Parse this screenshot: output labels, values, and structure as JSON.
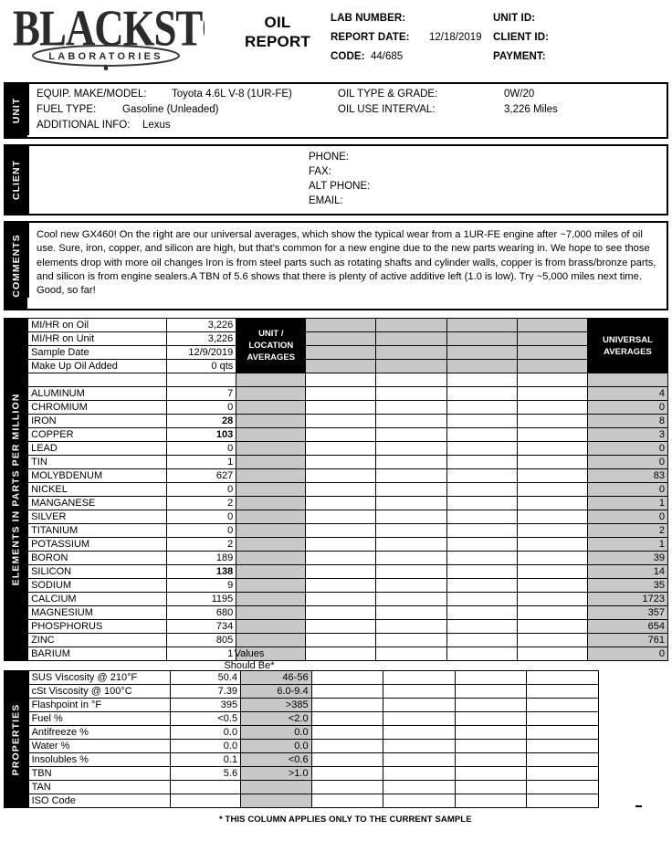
{
  "header": {
    "logo_main": "BLACKSTONE",
    "logo_sub": "LABORATORIES",
    "title_line1": "OIL",
    "title_line2": "REPORT",
    "lab_number_label": "LAB NUMBER:",
    "lab_number_value": "",
    "report_date_label": "REPORT DATE:",
    "report_date_value": "12/18/2019",
    "code_label": "CODE:",
    "code_value": "44/685",
    "unit_id_label": "UNIT ID:",
    "unit_id_value": "",
    "client_id_label": "CLIENT ID:",
    "client_id_value": "",
    "payment_label": "PAYMENT:",
    "payment_value": ""
  },
  "unit": {
    "tab": "UNIT",
    "equip_label": "EQUIP. MAKE/MODEL:",
    "equip_value": "Toyota 4.6L V-8 (1UR-FE)",
    "fuel_label": "FUEL TYPE:",
    "fuel_value": "Gasoline (Unleaded)",
    "additional_label": "ADDITIONAL INFO:",
    "additional_value": "Lexus",
    "oil_type_label": "OIL TYPE & GRADE:",
    "oil_type_value": "0W/20",
    "oil_interval_label": "OIL USE INTERVAL:",
    "oil_interval_value": "3,226 Miles"
  },
  "client": {
    "tab": "CLIENT",
    "phone_label": "PHONE:",
    "phone_value": "",
    "fax_label": "FAX:",
    "fax_value": "",
    "alt_phone_label": "ALT PHONE:",
    "alt_phone_value": "",
    "email_label": "EMAIL:",
    "email_value": ""
  },
  "comments": {
    "tab": "COMMENTS",
    "text": "Cool new GX460! On the right are our universal averages, which show the typical wear from a 1UR-FE engine after ~7,000 miles of oil use. Sure, iron, copper, and silicon are high, but that's common for a new engine due to the new parts wearing in. We hope to see those elements drop with more oil changes Iron is from steel parts such as rotating shafts and cylinder walls, copper is from brass/bronze parts, and silicon is from engine sealers.A TBN of 5.6 shows that there is plenty of active additive left (1.0 is low). Try ~5,000 miles next time. Good, so far!"
  },
  "elements": {
    "tab": "ELEMENTS IN PARTS PER MILLION",
    "unit_location_header": "UNIT /\nLOCATION\nAVERAGES",
    "unit_location_header_lines": [
      "UNIT /",
      "LOCATION",
      "AVERAGES"
    ],
    "universal_header_lines": [
      "UNIVERSAL",
      "AVERAGES"
    ],
    "sample_info": [
      {
        "label": "MI/HR on Oil",
        "value": "3,226"
      },
      {
        "label": "MI/HR on Unit",
        "value": "3,226"
      },
      {
        "label": "Sample Date",
        "value": "12/9/2019"
      },
      {
        "label": "Make Up Oil Added",
        "value": "0 qts"
      }
    ],
    "rows": [
      {
        "label": "ALUMINUM",
        "value": "7",
        "bold": false,
        "universal": "4"
      },
      {
        "label": "CHROMIUM",
        "value": "0",
        "bold": false,
        "universal": "0"
      },
      {
        "label": "IRON",
        "value": "28",
        "bold": true,
        "universal": "8"
      },
      {
        "label": "COPPER",
        "value": "103",
        "bold": true,
        "universal": "3"
      },
      {
        "label": "LEAD",
        "value": "0",
        "bold": false,
        "universal": "0"
      },
      {
        "label": "TIN",
        "value": "1",
        "bold": false,
        "universal": "0"
      },
      {
        "label": "MOLYBDENUM",
        "value": "627",
        "bold": false,
        "universal": "83"
      },
      {
        "label": "NICKEL",
        "value": "0",
        "bold": false,
        "universal": "0"
      },
      {
        "label": "MANGANESE",
        "value": "2",
        "bold": false,
        "universal": "1"
      },
      {
        "label": "SILVER",
        "value": "0",
        "bold": false,
        "universal": "0"
      },
      {
        "label": "TITANIUM",
        "value": "0",
        "bold": false,
        "universal": "2"
      },
      {
        "label": "POTASSIUM",
        "value": "2",
        "bold": false,
        "universal": "1"
      },
      {
        "label": "BORON",
        "value": "189",
        "bold": false,
        "universal": "39"
      },
      {
        "label": "SILICON",
        "value": "138",
        "bold": true,
        "universal": "14"
      },
      {
        "label": "SODIUM",
        "value": "9",
        "bold": false,
        "universal": "35"
      },
      {
        "label": "CALCIUM",
        "value": "1195",
        "bold": false,
        "universal": "1723"
      },
      {
        "label": "MAGNESIUM",
        "value": "680",
        "bold": false,
        "universal": "357"
      },
      {
        "label": "PHOSPHORUS",
        "value": "734",
        "bold": false,
        "universal": "654"
      },
      {
        "label": "ZINC",
        "value": "805",
        "bold": false,
        "universal": "761"
      },
      {
        "label": "BARIUM",
        "value": "1",
        "bold": false,
        "universal": "0"
      }
    ]
  },
  "properties": {
    "tab": "PROPERTIES",
    "values_header_lines": [
      "Values",
      "Should Be*"
    ],
    "rows": [
      {
        "label": "SUS Viscosity @ 210°F",
        "value": "50.4",
        "should_be": "46-56"
      },
      {
        "label": "cSt Viscosity @ 100°C",
        "value": "7.39",
        "should_be": "6.0-9.4"
      },
      {
        "label": "Flashpoint in °F",
        "value": "395",
        "should_be": ">385"
      },
      {
        "label": "Fuel %",
        "value": "<0.5",
        "should_be": "<2.0"
      },
      {
        "label": "Antifreeze %",
        "value": "0.0",
        "should_be": "0.0"
      },
      {
        "label": "Water %",
        "value": "0.0",
        "should_be": "0.0"
      },
      {
        "label": "Insolubles %",
        "value": "0.1",
        "should_be": "<0.6"
      },
      {
        "label": "TBN",
        "value": "5.6",
        "should_be": ">1.0"
      },
      {
        "label": "TAN",
        "value": "",
        "should_be": ""
      },
      {
        "label": "ISO Code",
        "value": "",
        "should_be": ""
      }
    ],
    "footnote": "* THIS COLUMN APPLIES ONLY TO THE CURRENT SAMPLE"
  },
  "colors": {
    "gray_fill": "#c8c8c8",
    "black": "#000000"
  }
}
